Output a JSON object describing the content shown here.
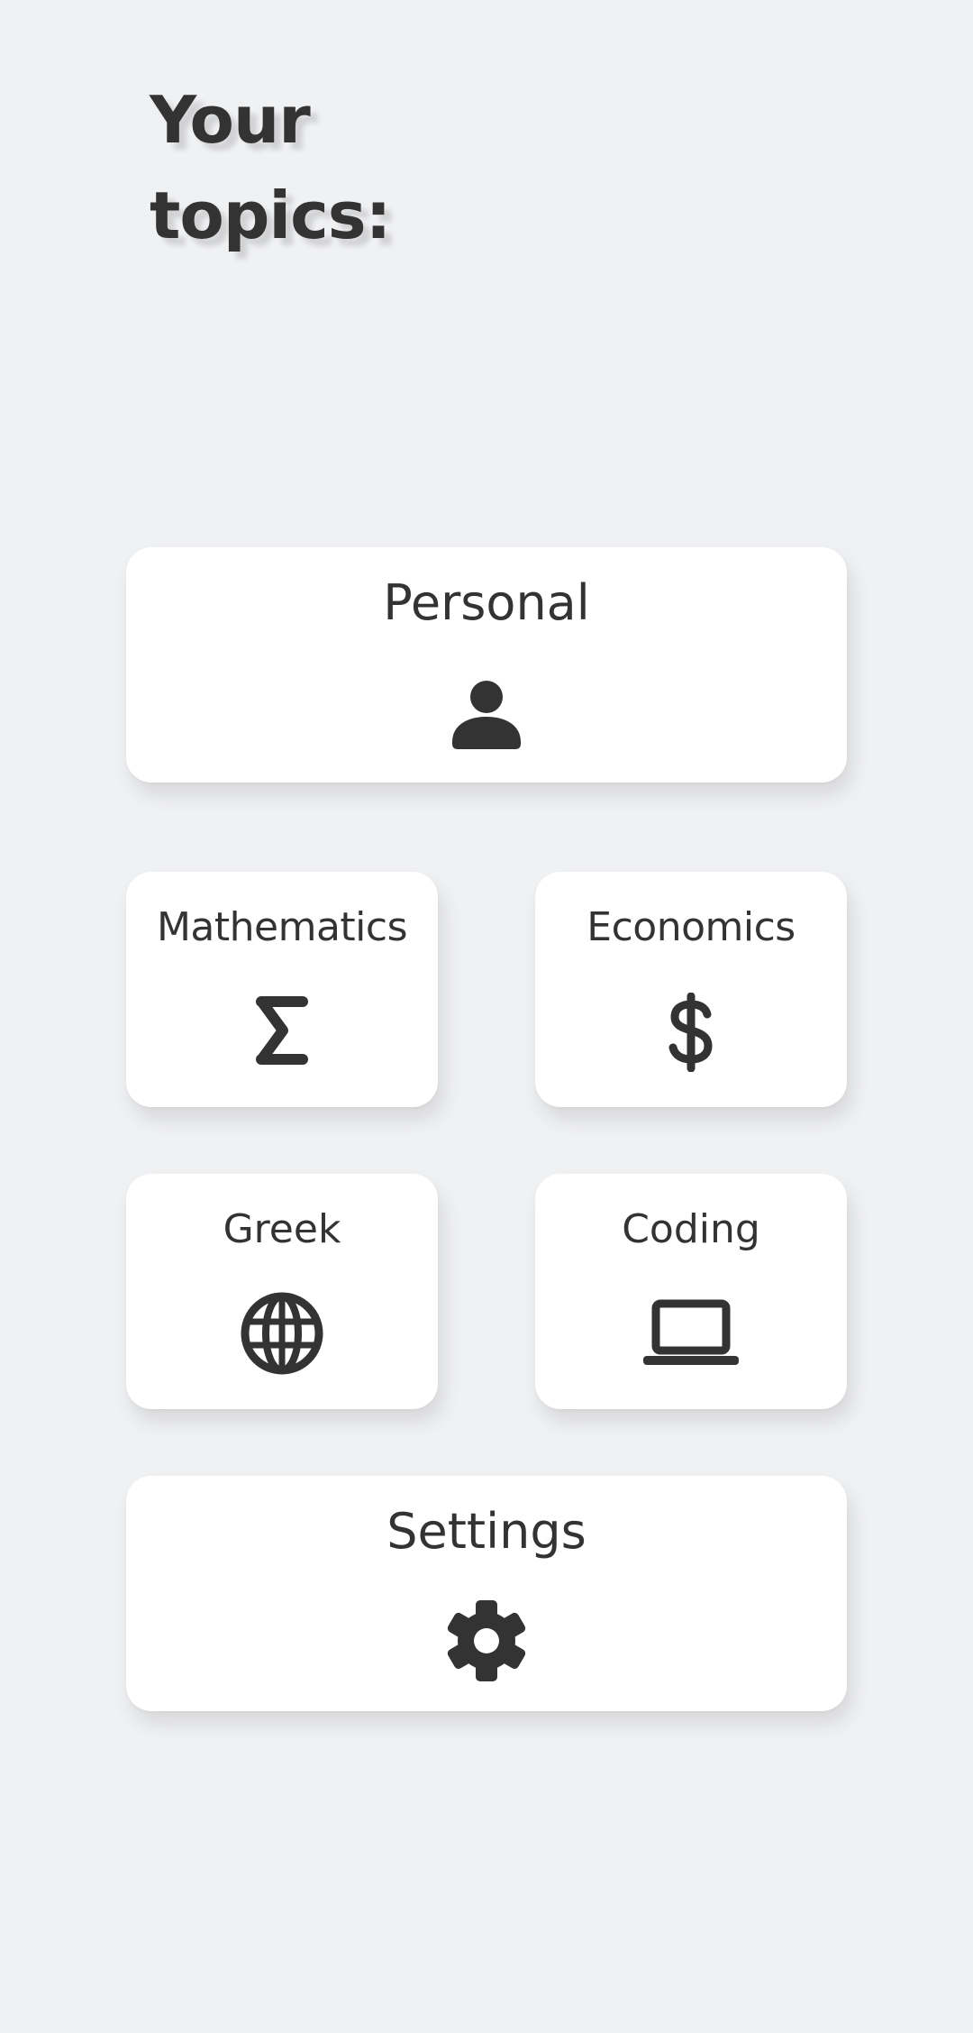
{
  "header": {
    "title_line1": "Your",
    "title_line2": "topics:"
  },
  "topics": [
    {
      "label": "Personal",
      "icon": "person-icon"
    },
    {
      "label": "Mathematics",
      "icon": "sigma-icon"
    },
    {
      "label": "Economics",
      "icon": "dollar-icon"
    },
    {
      "label": "Greek",
      "icon": "globe-icon"
    },
    {
      "label": "Coding",
      "icon": "laptop-icon"
    },
    {
      "label": "Settings",
      "icon": "gear-icon"
    }
  ],
  "colors": {
    "background": "#f0f1f3",
    "card": "#ffffff",
    "text": "#333333"
  }
}
